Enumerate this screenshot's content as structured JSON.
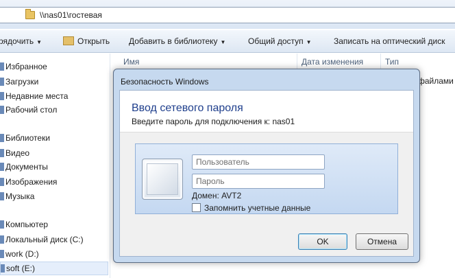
{
  "explorer": {
    "address_path": "\\\\nas01\\гостевая",
    "toolbar": {
      "organize": "рядочить",
      "open": "Открыть",
      "add_to_library": "Добавить в библиотеку",
      "share": "Общий доступ",
      "burn": "Записать на оптический диск"
    },
    "columns": {
      "name": "Имя",
      "date": "Дата изменения",
      "type": "Тип"
    },
    "behind_text": "файлами",
    "sidebar": [
      {
        "label": "Избранное",
        "kind": "header"
      },
      {
        "label": "Загрузки",
        "kind": "item"
      },
      {
        "label": "Недавние места",
        "kind": "item"
      },
      {
        "label": "Рабочий стол",
        "kind": "item"
      },
      {
        "label": "Библиотеки",
        "kind": "header"
      },
      {
        "label": "Видео",
        "kind": "item"
      },
      {
        "label": "Документы",
        "kind": "item"
      },
      {
        "label": "Изображения",
        "kind": "item"
      },
      {
        "label": "Музыка",
        "kind": "item"
      },
      {
        "label": "Компьютер",
        "kind": "header"
      },
      {
        "label": "Локальный диск (C:)",
        "kind": "item"
      },
      {
        "label": "work (D:)",
        "kind": "item"
      },
      {
        "label": "soft (E:)",
        "kind": "item",
        "selected": true
      }
    ]
  },
  "dialog": {
    "window_title": "Безопасность Windows",
    "heading": "Ввод сетевого пароля",
    "subheading": "Введите пароль для подключения к: nas01",
    "username_placeholder": "Пользователь",
    "password_placeholder": "Пароль",
    "domain": "Домен: AVT2",
    "remember_label": "Запомнить учетные данные",
    "ok_label": "OK",
    "cancel_label": "Отмена"
  }
}
